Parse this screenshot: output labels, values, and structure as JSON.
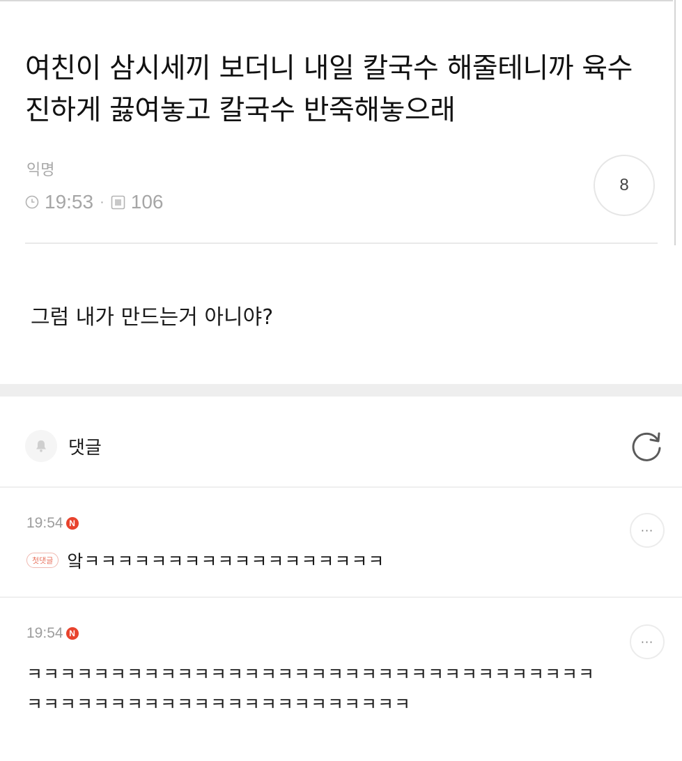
{
  "post": {
    "title": "여친이 삼시세끼 보더니 내일 칼국수 해줄테니까 육수 진하게 끓여놓고 칼국수 반죽해놓으래",
    "author": "익명",
    "time": "19:53",
    "separator": "·",
    "views": "106",
    "likes": "8",
    "body": "그럼 내가 만드는거 아니야?"
  },
  "comments_section": {
    "label": "댓글",
    "bell_icon": "bell-icon",
    "refresh_icon": "refresh-icon"
  },
  "comments": [
    {
      "time": "19:54",
      "new_badge": "N",
      "first_comment_badge": "첫댓글",
      "text": "앜ㅋㅋㅋㅋㅋㅋㅋㅋㅋㅋㅋㅋㅋㅋㅋㅋㅋㅋ",
      "more_label": "···"
    },
    {
      "time": "19:54",
      "new_badge": "N",
      "text": "ㅋㅋㅋㅋㅋㅋㅋㅋㅋㅋㅋㅋㅋㅋㅋㅋㅋㅋㅋㅋㅋㅋㅋㅋㅋㅋㅋㅋㅋㅋㅋㅋㅋㅋㅋㅋㅋㅋㅋㅋㅋㅋㅋㅋㅋㅋㅋㅋㅋㅋㅋㅋㅋㅋㅋㅋㅋ",
      "more_label": "···"
    }
  ],
  "colors": {
    "new_badge": "#e8432d",
    "muted_text": "#a6a6a6",
    "band": "#eeeeee"
  }
}
